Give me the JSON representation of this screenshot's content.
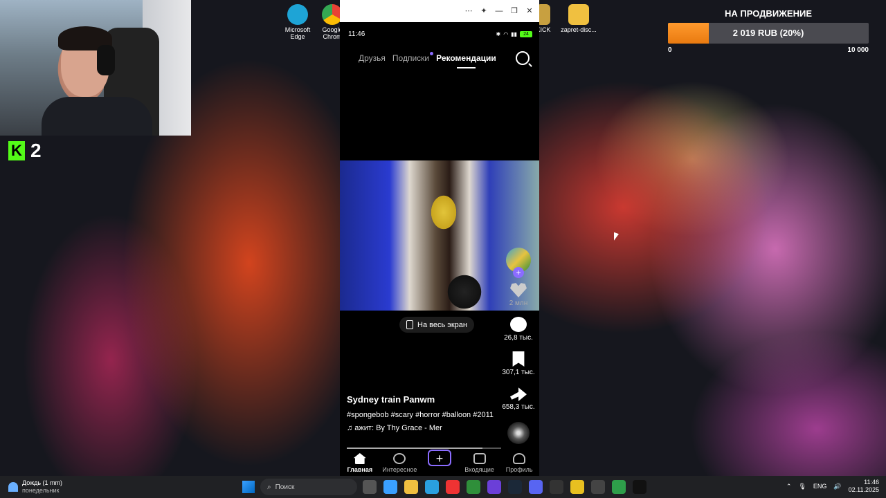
{
  "desktop": {
    "icons": [
      {
        "label": "Microsoft Edge",
        "color": "#1ea4d6"
      },
      {
        "label": "Google Chrom",
        "color": "#e94235"
      },
      {
        "label": "KICK",
        "color": "#c8a040"
      },
      {
        "label": "zapret-disc...",
        "color": "#f0c040"
      }
    ]
  },
  "stream": {
    "kick_letter": "K",
    "viewer_count": "2"
  },
  "donation": {
    "title": "НА ПРОДВИЖЕНИЕ",
    "amount_text": "2 019 RUB (20%)",
    "progress_fraction": 0.2019,
    "min_label": "0",
    "max_label": "10 000",
    "fill_color": "#f08a1c"
  },
  "phone": {
    "window_buttons": [
      "⋯",
      "✦",
      "—",
      "❐",
      "✕"
    ],
    "status": {
      "time": "11:46",
      "battery": "24"
    },
    "tabs": [
      {
        "label": "Друзья",
        "active": false
      },
      {
        "label": "Подписки",
        "active": false
      },
      {
        "label": "Рекомендации",
        "active": true
      }
    ],
    "fullscreen_label": "На весь экран",
    "actions": {
      "likes": "2 млн",
      "comments": "26,8 тыс.",
      "saves": "307,1 тыс.",
      "shares": "658,3 тыс."
    },
    "caption": {
      "title": "Sydney train Panwm",
      "tags": "#spongebob #scary #horror #balloon #2011",
      "music": "♫ ажит: By Thy Grace - Mer"
    },
    "playback_fraction": 0.88,
    "nav": [
      {
        "label": "Главная",
        "active": true
      },
      {
        "label": "Интересное",
        "active": false
      },
      {
        "label": "+",
        "active": false
      },
      {
        "label": "Входящие",
        "active": false
      },
      {
        "label": "Профиль",
        "active": false
      }
    ]
  },
  "taskbar": {
    "weather_line1": "Дождь (1 mm)",
    "weather_line2": "понедельник",
    "search_placeholder": "Поиск",
    "app_colors": [
      "#555",
      "#3aa0ff",
      "#f0c040",
      "#2aa0e0",
      "#e33",
      "#2f8f3a",
      "#6b3fd8",
      "#1b2838",
      "#5865f2",
      "#333",
      "#e8c020",
      "#444",
      "#2e9e4a",
      "#111"
    ],
    "language": "ENG",
    "time": "11:46",
    "date": "02.11.2025"
  }
}
